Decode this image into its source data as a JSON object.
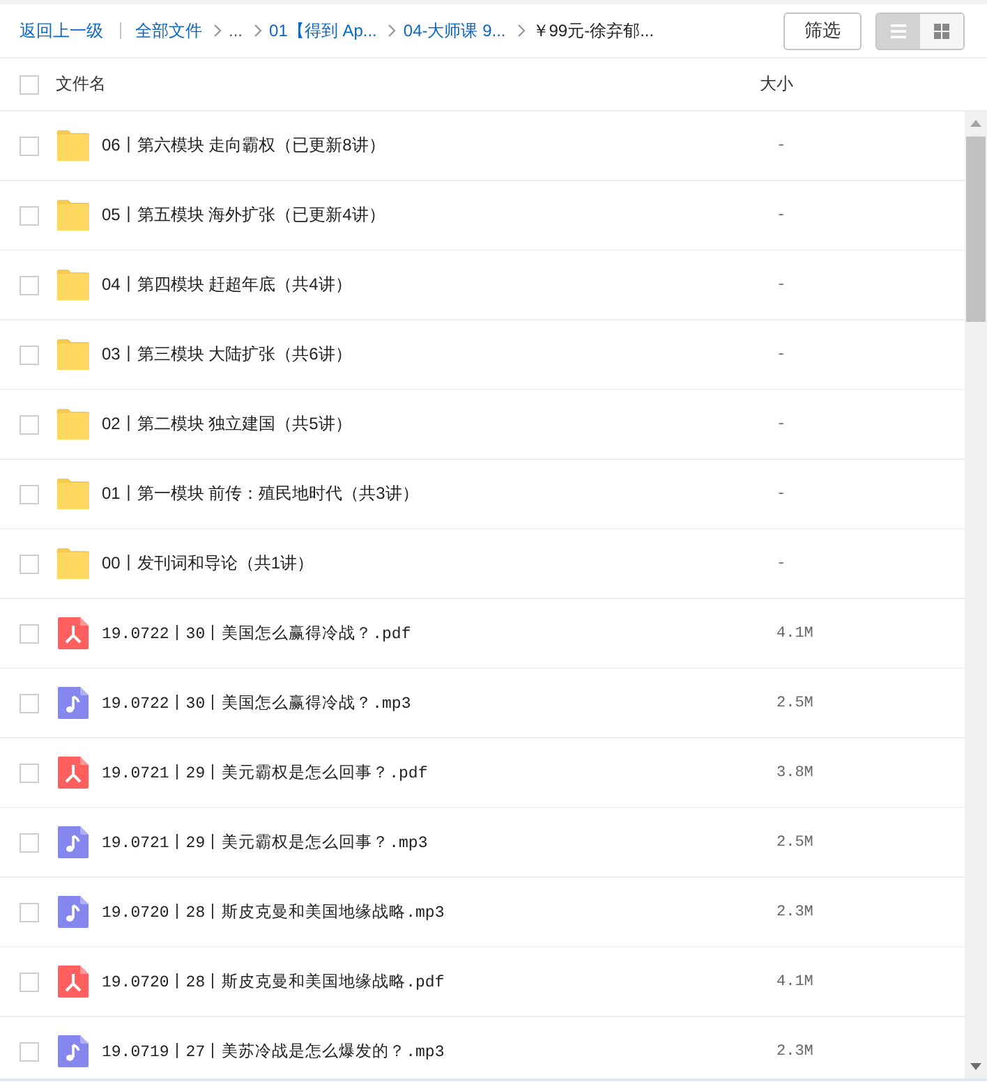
{
  "toolbar": {
    "back_link": "返回上一级",
    "breadcrumbs": [
      {
        "kind": "link",
        "label": "全部文件"
      },
      {
        "kind": "more",
        "label": "..."
      },
      {
        "kind": "link",
        "label": "01【得到 Ap..."
      },
      {
        "kind": "link",
        "label": "04-大师课 9..."
      },
      {
        "kind": "current",
        "label": "￥99元-徐弃郁..."
      }
    ],
    "filter_button": "筛选",
    "view_modes": [
      {
        "kind": "list",
        "selected": true
      },
      {
        "kind": "grid",
        "selected": false
      }
    ]
  },
  "table": {
    "columns": [
      "文件名",
      "大小"
    ],
    "all_checked": false,
    "rows": [
      {
        "kind": "folder",
        "name": "06丨第六模块 走向霸权（已更新8讲）",
        "size": "-",
        "checked": false
      },
      {
        "kind": "folder",
        "name": "05丨第五模块 海外扩张（已更新4讲）",
        "size": "-",
        "checked": false
      },
      {
        "kind": "folder",
        "name": "04丨第四模块 赶超年底（共4讲）",
        "size": "-",
        "checked": false
      },
      {
        "kind": "folder",
        "name": "03丨第三模块 大陆扩张（共6讲）",
        "size": "-",
        "checked": false
      },
      {
        "kind": "folder",
        "name": "02丨第二模块 独立建国（共5讲）",
        "size": "-",
        "checked": false
      },
      {
        "kind": "folder",
        "name": "01丨第一模块 前传：殖民地时代（共3讲）",
        "size": "-",
        "checked": false
      },
      {
        "kind": "folder",
        "name": "00丨发刊词和导论（共1讲）",
        "size": "-",
        "checked": false
      },
      {
        "kind": "pdf",
        "name": "19.0722丨30丨美国怎么赢得冷战？.pdf",
        "size": "4.1M",
        "checked": false
      },
      {
        "kind": "audio",
        "name": "19.0722丨30丨美国怎么赢得冷战？.mp3",
        "size": "2.5M",
        "checked": false
      },
      {
        "kind": "pdf",
        "name": "19.0721丨29丨美元霸权是怎么回事？.pdf",
        "size": "3.8M",
        "checked": false
      },
      {
        "kind": "audio",
        "name": "19.0721丨29丨美元霸权是怎么回事？.mp3",
        "size": "2.5M",
        "checked": false
      },
      {
        "kind": "audio",
        "name": "19.0720丨28丨斯皮克曼和美国地缘战略.mp3",
        "size": "2.3M",
        "checked": false
      },
      {
        "kind": "pdf",
        "name": "19.0720丨28丨斯皮克曼和美国地缘战略.pdf",
        "size": "4.1M",
        "checked": false
      },
      {
        "kind": "audio",
        "name": "19.0719丨27丨美苏冷战是怎么爆发的？.mp3",
        "size": "2.3M",
        "checked": false
      }
    ]
  }
}
